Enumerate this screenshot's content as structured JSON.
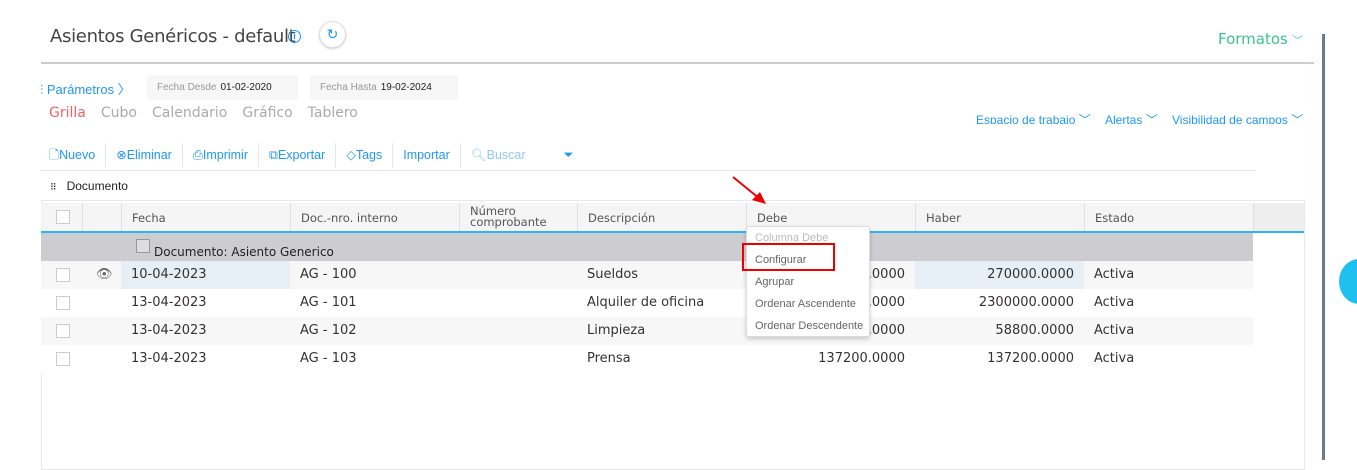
{
  "header": {
    "title": "Asientos Genéricos - default",
    "formatos": "Formatos"
  },
  "params": {
    "label": "Parámetros",
    "desde_label": "Fecha Desde",
    "desde": "01-02-2020",
    "hasta_label": "Fecha Hasta",
    "hasta": "19-02-2024"
  },
  "views": [
    "Grilla",
    "Cubo",
    "Calendario",
    "Gráfico",
    "Tablero"
  ],
  "right_links": [
    "Espacio de trabajo",
    "Alertas",
    "Visibilidad de campos"
  ],
  "toolbar": [
    "Nuevo",
    "Eliminar",
    "Imprimir",
    "Exportar",
    "Tags",
    "Importar",
    "Buscar"
  ],
  "group_panel": "Documento",
  "columns": [
    "Fecha",
    "Doc.-nro. interno",
    "Número comprobante",
    "Descripción",
    "Debe",
    "Haber",
    "Estado"
  ],
  "group_row": "Documento: Asiento Generico",
  "rows": [
    {
      "fecha": "10-04-2023",
      "doc": "AG - 100",
      "desc": "Sueldos",
      "debe": ".0000",
      "haber": "270000.0000",
      "estado": "Activa"
    },
    {
      "fecha": "13-04-2023",
      "doc": "AG - 101",
      "desc": "Alquiler de oficina",
      "debe": ".0000",
      "haber": "2300000.0000",
      "estado": "Activa"
    },
    {
      "fecha": "13-04-2023",
      "doc": "AG - 102",
      "desc": "Limpieza",
      "debe": ".0000",
      "haber": "58800.0000",
      "estado": "Activa"
    },
    {
      "fecha": "13-04-2023",
      "doc": "AG - 103",
      "desc": "Prensa",
      "debe": "137200.0000",
      "haber": "137200.0000",
      "estado": "Activa"
    }
  ],
  "context_menu": {
    "title": "Columna Debe",
    "items": [
      "Configurar",
      "Agrupar",
      "Ordenar Ascendente",
      "Ordenar Descendente"
    ]
  }
}
